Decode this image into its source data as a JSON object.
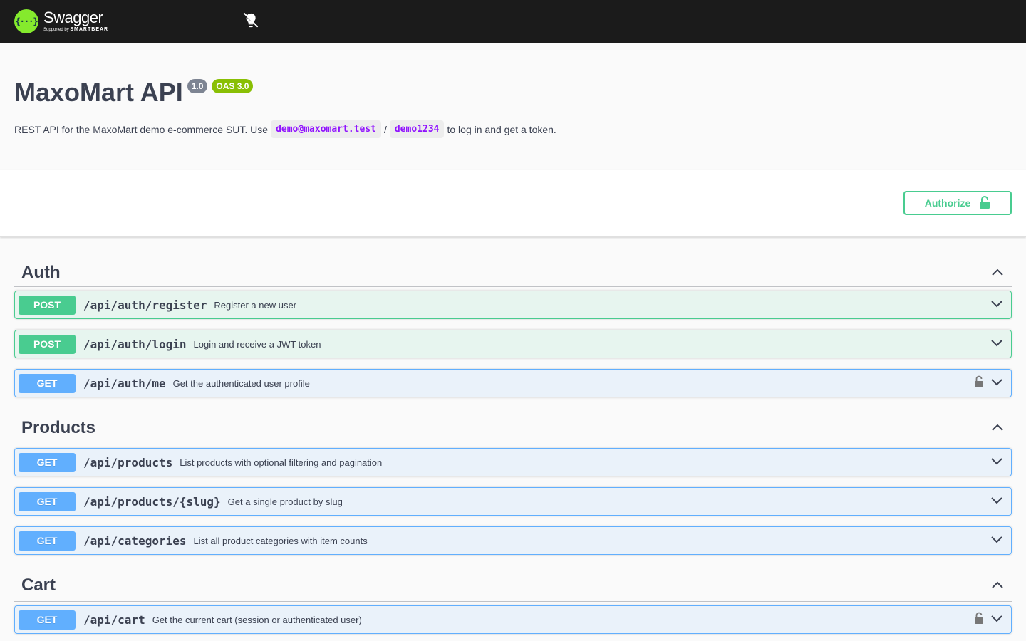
{
  "topbar": {
    "logo_glyph": "{···}",
    "logo_name": "Swagger",
    "logo_supported": "Supported by",
    "logo_company": "SMARTBEAR",
    "theme_icon": "lightbulb-off-icon"
  },
  "info": {
    "title": "MaxoMart API",
    "version": "1.0",
    "oas": "OAS 3.0",
    "desc_prefix": "REST API for the MaxoMart demo e-commerce SUT. Use",
    "email": "demo@maxomart.test",
    "separator": "/",
    "password": "demo1234",
    "desc_suffix": "to log in and get a token."
  },
  "authorize": {
    "label": "Authorize",
    "icon": "unlock-icon"
  },
  "colors": {
    "post": "#49cc90",
    "get": "#61affe",
    "topbar": "#1b1b1b",
    "code": "#9012fe"
  },
  "tags": [
    {
      "name": "Auth",
      "operations": [
        {
          "method": "POST",
          "path": "/api/auth/register",
          "summary": "Register a new user",
          "locked": false
        },
        {
          "method": "POST",
          "path": "/api/auth/login",
          "summary": "Login and receive a JWT token",
          "locked": false
        },
        {
          "method": "GET",
          "path": "/api/auth/me",
          "summary": "Get the authenticated user profile",
          "locked": true
        }
      ]
    },
    {
      "name": "Products",
      "operations": [
        {
          "method": "GET",
          "path": "/api/products",
          "summary": "List products with optional filtering and pagination",
          "locked": false
        },
        {
          "method": "GET",
          "path": "/api/products/{slug}",
          "summary": "Get a single product by slug",
          "locked": false
        },
        {
          "method": "GET",
          "path": "/api/categories",
          "summary": "List all product categories with item counts",
          "locked": false
        }
      ]
    },
    {
      "name": "Cart",
      "operations": [
        {
          "method": "GET",
          "path": "/api/cart",
          "summary": "Get the current cart (session or authenticated user)",
          "locked": true
        }
      ]
    }
  ]
}
